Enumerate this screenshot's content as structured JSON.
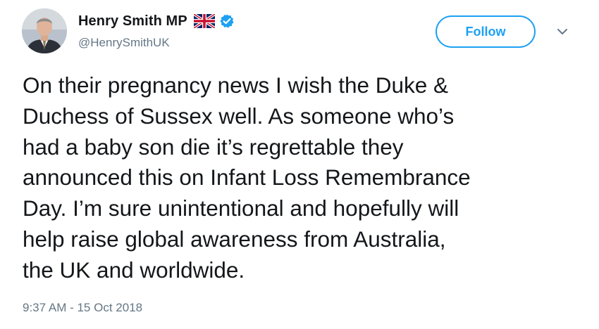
{
  "author": {
    "display_name": "Henry Smith MP",
    "handle": "@HenrySmithUK",
    "flag_icon": "uk-flag-icon",
    "verified_icon": "verified-badge-icon",
    "verified_color": "#1da1f2"
  },
  "actions": {
    "follow_label": "Follow",
    "menu_icon": "chevron-down-icon",
    "accent_color": "#1da1f2"
  },
  "tweet": {
    "lines": [
      "On their pregnancy news I wish the Duke &",
      "Duchess of Sussex well. As someone who’s",
      "had a baby son die it’s regrettable they",
      "announced this on Infant Loss Remembrance",
      "Day. I’m sure unintentional and hopefully will",
      "help raise global awareness from Australia,",
      "the UK and worldwide."
    ],
    "timestamp": "9:37 AM - 15 Oct 2018"
  }
}
